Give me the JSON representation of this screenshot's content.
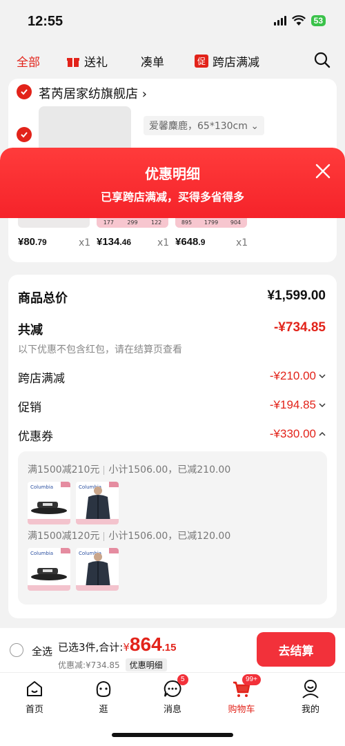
{
  "status": {
    "time": "12:55",
    "battery": "53"
  },
  "top_tabs": [
    "全部",
    "送礼",
    "凑单",
    "跨店满减"
  ],
  "top_tab_tag": "促",
  "shop": {
    "name": "茗芮居家纺旗舰店",
    "sku": "爱馨麋鹿，65*130cm"
  },
  "sheet": {
    "title": "优惠明细",
    "subtitle": "已享跨店满减，买得多省得多"
  },
  "items": [
    {
      "price_int": "¥80",
      "price_dec": ".79",
      "qty": "x1"
    },
    {
      "price_int": "¥134",
      "price_dec": ".46",
      "qty": "x1"
    },
    {
      "price_int": "¥648",
      "price_dec": ".9",
      "qty": "x1"
    }
  ],
  "summary": {
    "total_label": "商品总价",
    "total_value": "¥1,599.00",
    "reduce_label": "共减",
    "reduce_value": "-¥734.85",
    "note": "以下优惠不包含红包，请在结算页查看",
    "rows": [
      {
        "label": "跨店满减",
        "value": "-¥210.00"
      },
      {
        "label": "促销",
        "value": "-¥194.85"
      },
      {
        "label": "优惠券",
        "value": "-¥330.00"
      }
    ]
  },
  "coupons": [
    {
      "rule": "满1500减210元",
      "detail": "小计1506.00，已减210.00"
    },
    {
      "rule": "满1500减120元",
      "detail": "小计1506.00，已减120.00"
    }
  ],
  "thumb_brand": "Columbia",
  "checkout": {
    "select_all": "全选",
    "selected": "已选3件,合计:",
    "currency": "¥",
    "amount_int": "864",
    "amount_dec": ".15",
    "saved": "优惠减:¥734.85",
    "detail_link": "优惠明细",
    "pay": "去结算"
  },
  "tabbar": [
    {
      "label": "首页",
      "icon": "home-icon"
    },
    {
      "label": "逛",
      "icon": "explore-icon"
    },
    {
      "label": "消息",
      "icon": "message-icon",
      "badge": "5"
    },
    {
      "label": "购物车",
      "icon": "cart-icon",
      "badge": "99+"
    },
    {
      "label": "我的",
      "icon": "profile-icon"
    }
  ],
  "colors": {
    "accent": "#e2231a",
    "sheet_header": "#f5232a"
  }
}
